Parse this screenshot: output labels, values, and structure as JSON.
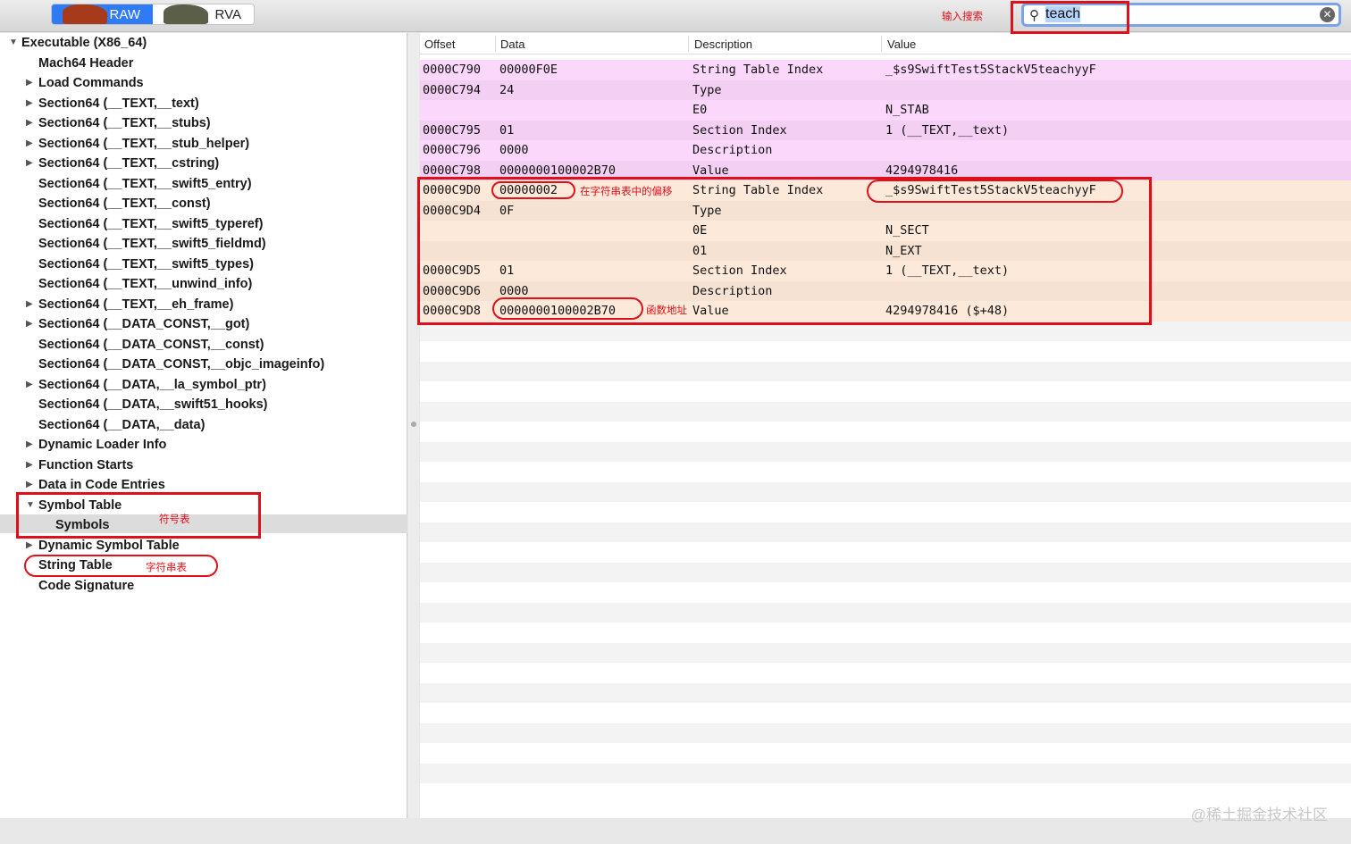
{
  "toolbar": {
    "raw_label": "RAW",
    "rva_label": "RVA",
    "search_value": "teach"
  },
  "tree": [
    {
      "label": "Executable  (X86_64)",
      "level": 0,
      "arrow": "down"
    },
    {
      "label": "Mach64 Header",
      "level": 1,
      "arrow": ""
    },
    {
      "label": "Load Commands",
      "level": 1,
      "arrow": "right"
    },
    {
      "label": "Section64 (__TEXT,__text)",
      "level": 1,
      "arrow": "right"
    },
    {
      "label": "Section64 (__TEXT,__stubs)",
      "level": 1,
      "arrow": "right"
    },
    {
      "label": "Section64 (__TEXT,__stub_helper)",
      "level": 1,
      "arrow": "right"
    },
    {
      "label": "Section64 (__TEXT,__cstring)",
      "level": 1,
      "arrow": "right"
    },
    {
      "label": "Section64 (__TEXT,__swift5_entry)",
      "level": 1,
      "arrow": ""
    },
    {
      "label": "Section64 (__TEXT,__const)",
      "level": 1,
      "arrow": ""
    },
    {
      "label": "Section64 (__TEXT,__swift5_typeref)",
      "level": 1,
      "arrow": ""
    },
    {
      "label": "Section64 (__TEXT,__swift5_fieldmd)",
      "level": 1,
      "arrow": ""
    },
    {
      "label": "Section64 (__TEXT,__swift5_types)",
      "level": 1,
      "arrow": ""
    },
    {
      "label": "Section64 (__TEXT,__unwind_info)",
      "level": 1,
      "arrow": ""
    },
    {
      "label": "Section64 (__TEXT,__eh_frame)",
      "level": 1,
      "arrow": "right"
    },
    {
      "label": "Section64 (__DATA_CONST,__got)",
      "level": 1,
      "arrow": "right"
    },
    {
      "label": "Section64 (__DATA_CONST,__const)",
      "level": 1,
      "arrow": ""
    },
    {
      "label": "Section64 (__DATA_CONST,__objc_imageinfo)",
      "level": 1,
      "arrow": ""
    },
    {
      "label": "Section64 (__DATA,__la_symbol_ptr)",
      "level": 1,
      "arrow": "right"
    },
    {
      "label": "Section64 (__DATA,__swift51_hooks)",
      "level": 1,
      "arrow": ""
    },
    {
      "label": "Section64 (__DATA,__data)",
      "level": 1,
      "arrow": ""
    },
    {
      "label": "Dynamic Loader Info",
      "level": 1,
      "arrow": "right"
    },
    {
      "label": "Function Starts",
      "level": 1,
      "arrow": "right"
    },
    {
      "label": "Data in Code Entries",
      "level": 1,
      "arrow": "right"
    },
    {
      "label": "Symbol Table",
      "level": 1,
      "arrow": "down"
    },
    {
      "label": "Symbols",
      "level": 2,
      "arrow": ""
    },
    {
      "label": "Dynamic Symbol Table",
      "level": 1,
      "arrow": "right"
    },
    {
      "label": "String Table",
      "level": 1,
      "arrow": ""
    },
    {
      "label": "Code Signature",
      "level": 1,
      "arrow": ""
    }
  ],
  "table": {
    "columns": [
      "Offset",
      "Data",
      "Description",
      "Value"
    ],
    "rows": [
      {
        "offset": "0000C790",
        "data": "00000F0E",
        "desc": "String Table Index",
        "value": "_$s9SwiftTest5StackV5teachyyF",
        "group": "a"
      },
      {
        "offset": "0000C794",
        "data": "24",
        "desc": "Type",
        "value": "",
        "group": "a"
      },
      {
        "offset": "",
        "data": "",
        "desc": "E0",
        "value": "N_STAB",
        "group": "a"
      },
      {
        "offset": "0000C795",
        "data": "01",
        "desc": "Section Index",
        "value": "1 (__TEXT,__text)",
        "group": "a"
      },
      {
        "offset": "0000C796",
        "data": "0000",
        "desc": "Description",
        "value": "",
        "group": "a"
      },
      {
        "offset": "0000C798",
        "data": "0000000100002B70",
        "desc": "Value",
        "value": "4294978416",
        "group": "a"
      },
      {
        "offset": "0000C9D0",
        "data": "00000002",
        "desc": "String Table Index",
        "value": "_$s9SwiftTest5StackV5teachyyF",
        "group": "b"
      },
      {
        "offset": "0000C9D4",
        "data": "0F",
        "desc": "Type",
        "value": "",
        "group": "b"
      },
      {
        "offset": "",
        "data": "",
        "desc": "0E",
        "value": "N_SECT",
        "group": "b"
      },
      {
        "offset": "",
        "data": "",
        "desc": "01",
        "value": "N_EXT",
        "group": "b"
      },
      {
        "offset": "0000C9D5",
        "data": "01",
        "desc": "Section Index",
        "value": "1 (__TEXT,__text)",
        "group": "b"
      },
      {
        "offset": "0000C9D6",
        "data": "0000",
        "desc": "Description",
        "value": "",
        "group": "b"
      },
      {
        "offset": "0000C9D8",
        "data": "0000000100002B70",
        "desc": "Value",
        "value": "4294978416 ($+48)",
        "group": "b"
      }
    ]
  },
  "annotations": {
    "search": "输入搜索",
    "offset": "在字符串表中的偏移",
    "address": "函数地址",
    "symtab": "符号表",
    "strtab": "字符串表"
  },
  "watermark": "@稀土掘金技术社区",
  "colors": {
    "pinkA": "#fbd7fb",
    "pinkB": "#f4cff4",
    "orangeA": "#fde9da",
    "orangeB": "#f6e2d3",
    "red": "#e0101a",
    "accent": "#2f7bf5"
  }
}
